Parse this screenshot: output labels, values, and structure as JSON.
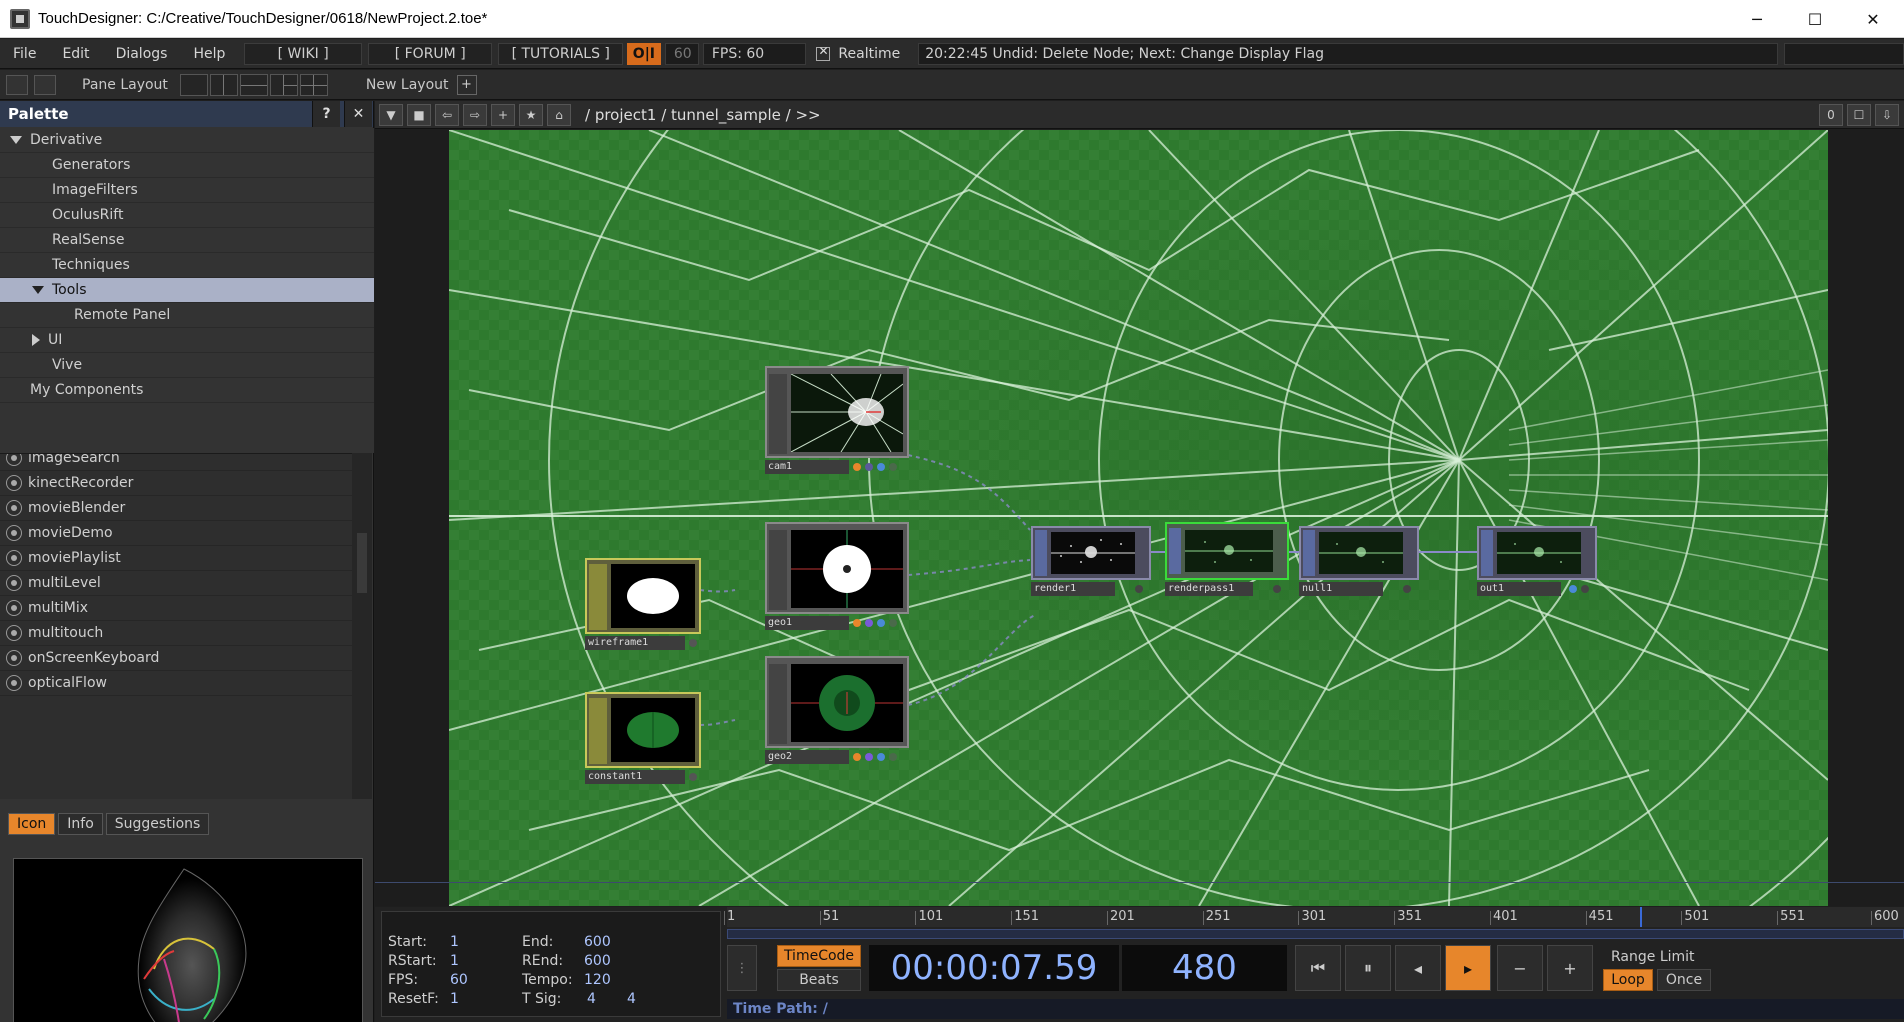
{
  "window": {
    "title": "TouchDesigner: C:/Creative/TouchDesigner/0618/NewProject.2.toe*",
    "minimize": "─",
    "maximize": "☐",
    "close": "✕"
  },
  "menubar": {
    "items": [
      "File",
      "Edit",
      "Dialogs",
      "Help"
    ],
    "wiki": "[ WIKI ]",
    "forum": "[ FORUM ]",
    "tutorials": "[ TUTORIALS ]",
    "oi": "O|I",
    "fps_cap": "60",
    "fps_label": "FPS:  60",
    "realtime_label": "Realtime",
    "status_message": "20:22:45 Undid: Delete Node; Next: Change Display Flag"
  },
  "toolbar": {
    "pane_layout_label": "Pane Layout",
    "new_layout_label": "New Layout",
    "add_label": "+"
  },
  "palette": {
    "title": "Palette",
    "help": "?",
    "close": "✕",
    "tree": [
      {
        "label": "Derivative",
        "indent": 0,
        "expander": "down",
        "selected": false
      },
      {
        "label": "Generators",
        "indent": 1,
        "expander": "",
        "selected": false
      },
      {
        "label": "ImageFilters",
        "indent": 1,
        "expander": "",
        "selected": false
      },
      {
        "label": "OculusRift",
        "indent": 1,
        "expander": "",
        "selected": false
      },
      {
        "label": "RealSense",
        "indent": 1,
        "expander": "",
        "selected": false
      },
      {
        "label": "Techniques",
        "indent": 1,
        "expander": "",
        "selected": false
      },
      {
        "label": "Tools",
        "indent": 1,
        "expander": "down",
        "selected": true
      },
      {
        "label": "Remote Panel",
        "indent": 2,
        "expander": "",
        "selected": false
      },
      {
        "label": "UI",
        "indent": 1,
        "expander": "right",
        "selected": false
      },
      {
        "label": "Vive",
        "indent": 1,
        "expander": "",
        "selected": false
      },
      {
        "label": "My Components",
        "indent": 0,
        "expander": "",
        "selected": false
      }
    ],
    "components": [
      "imageSearch",
      "kinectRecorder",
      "movieBlender",
      "movieDemo",
      "moviePlaylist",
      "multiLevel",
      "multiMix",
      "multitouch",
      "onScreenKeyboard",
      "opticalFlow"
    ],
    "tabs": [
      "Icon",
      "Info",
      "Suggestions"
    ],
    "active_tab": "Icon"
  },
  "network": {
    "path": "/ project1 / tunnel_sample / >>",
    "right_badge": "0",
    "nodes": {
      "cam1": "cam1",
      "geo1": "geo1",
      "geo2": "geo2",
      "wireframe1": "wireframe1",
      "constant1": "constant1",
      "render1": "render1",
      "renderpass1": "renderpass1",
      "null1": "null1",
      "out1": "out1"
    }
  },
  "timeline": {
    "start_label": "Start:",
    "start": "1",
    "end_label": "End:",
    "end": "600",
    "rstart_label": "RStart:",
    "rstart": "1",
    "rend_label": "REnd:",
    "rend": "600",
    "fps_label": "FPS:",
    "fps": "60",
    "tempo_label": "Tempo:",
    "tempo": "120",
    "resetf_label": "ResetF:",
    "resetf": "1",
    "tsig_label": "T Sig:",
    "tsig_a": "4",
    "tsig_b": "4",
    "ruler": [
      "1",
      "51",
      "101",
      "151",
      "201",
      "251",
      "301",
      "351",
      "401",
      "451",
      "501",
      "551",
      "600"
    ],
    "timecode_btn": "TimeCode",
    "beats_btn": "Beats",
    "timecode": "00:00:07.59",
    "frame": "480",
    "range_limit": "Range Limit",
    "loop": "Loop",
    "once": "Once",
    "time_path": "Time Path: /",
    "playhead_frame": 480,
    "colors": {
      "accent": "#e7862b",
      "timecode": "#8fb3ff",
      "network_green": "#2f7d2f"
    }
  }
}
